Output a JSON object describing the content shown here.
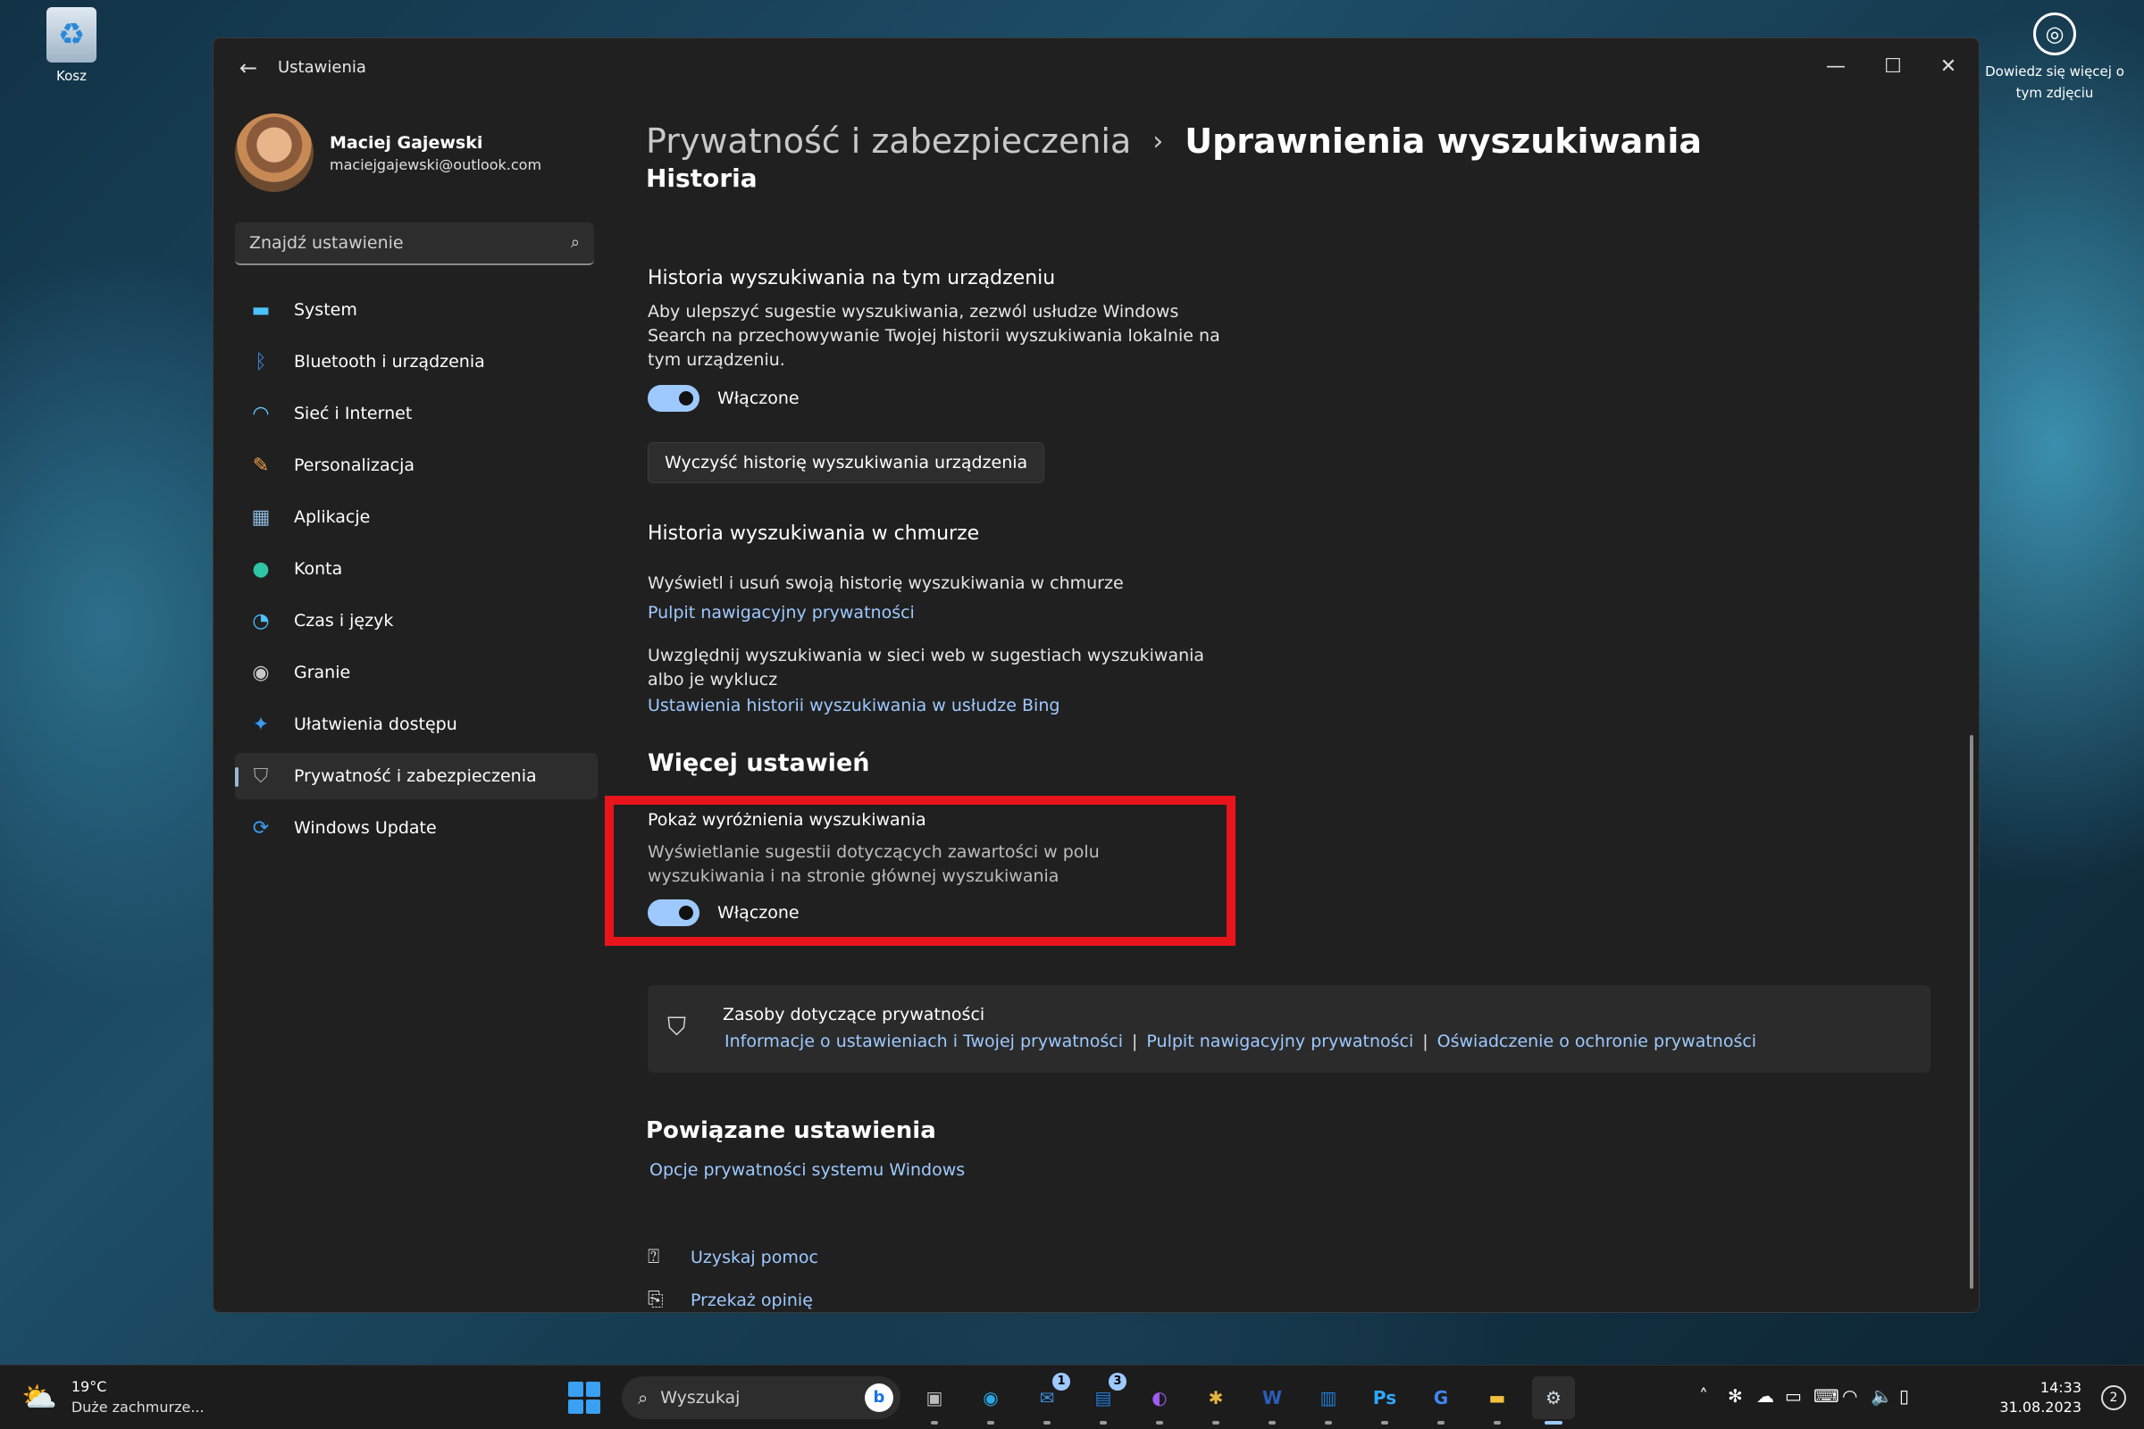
{
  "desktop": {
    "recycle_label": "Kosz",
    "learn_more": "Dowiedz się więcej o tym zdjęciu"
  },
  "window": {
    "title": "Ustawienia",
    "controls": {
      "minimize": "—",
      "maximize": "☐",
      "close": "✕"
    }
  },
  "profile": {
    "name": "Maciej Gajewski",
    "email": "maciejgajewski@outlook.com"
  },
  "search": {
    "placeholder": "Znajdź ustawienie"
  },
  "sidebar": {
    "items": [
      {
        "label": "System",
        "icon": "monitor-icon",
        "color": "#4cc2ff"
      },
      {
        "label": "Bluetooth i urządzenia",
        "icon": "bluetooth-icon",
        "color": "#3a8dde"
      },
      {
        "label": "Sieć i Internet",
        "icon": "wifi-icon",
        "color": "#60cdff"
      },
      {
        "label": "Personalizacja",
        "icon": "brush-icon",
        "color": "#f0a04b"
      },
      {
        "label": "Aplikacje",
        "icon": "apps-icon",
        "color": "#8ab4d8"
      },
      {
        "label": "Konta",
        "icon": "user-icon",
        "color": "#2ec4a4"
      },
      {
        "label": "Czas i język",
        "icon": "clock-globe-icon",
        "color": "#4cc2ff"
      },
      {
        "label": "Granie",
        "icon": "gamepad-icon",
        "color": "#c8c8c8"
      },
      {
        "label": "Ułatwienia dostępu",
        "icon": "accessibility-icon",
        "color": "#3a9bf0"
      },
      {
        "label": "Prywatność i zabezpieczenia",
        "icon": "shield-icon",
        "color": "#a8a8a8",
        "active": true
      },
      {
        "label": "Windows Update",
        "icon": "update-icon",
        "color": "#3a9bf0"
      }
    ]
  },
  "breadcrumb": {
    "parent": "Prywatność i zabezpieczenia",
    "separator": "›",
    "current": "Uprawnienia wyszukiwania"
  },
  "history": {
    "section_title": "Historia",
    "device": {
      "title": "Historia wyszukiwania na tym urządzeniu",
      "description": "Aby ulepszyć sugestie wyszukiwania, zezwól usłudze Windows Search na przechowywanie Twojej historii wyszukiwania lokalnie na tym urządzeniu.",
      "toggle_label": "Włączone",
      "clear_button": "Wyczyść historię wyszukiwania urządzenia"
    },
    "cloud": {
      "title": "Historia wyszukiwania w chmurze",
      "view_text": "Wyświetl i usuń swoją historię wyszukiwania w chmurze",
      "view_link": "Pulpit nawigacyjny prywatności",
      "web_text": "Uwzględnij wyszukiwania w sieci web w sugestiach wyszukiwania albo je wyklucz",
      "web_link": "Ustawienia historii wyszukiwania w usłudze Bing"
    }
  },
  "more_settings": {
    "title": "Więcej ustawień",
    "highlights": {
      "title": "Pokaż wyróżnienia wyszukiwania",
      "description": "Wyświetlanie sugestii dotyczących zawartości w polu wyszukiwania i na stronie głównej wyszukiwania",
      "toggle_label": "Włączone",
      "highlight_color": "#e8141c"
    }
  },
  "resources": {
    "title": "Zasoby dotyczące prywatności",
    "links": [
      "Informacje o ustawieniach i Twojej prywatności",
      "Pulpit nawigacyjny prywatności",
      "Oświadczenie o ochronie prywatności"
    ],
    "separator": "|"
  },
  "related": {
    "title": "Powiązane ustawienia",
    "link": "Opcje prywatności systemu Windows"
  },
  "footer": {
    "help": "Uzyskaj pomoc",
    "feedback": "Przekaż opinię"
  },
  "taskbar": {
    "weather_temp": "19°C",
    "weather_desc": "Duże zachmurze...",
    "search_text": "Wyszukaj",
    "bing_glyph": "b",
    "apps": [
      {
        "name": "task-view",
        "glyph": "▣",
        "color": "#bbbbbb"
      },
      {
        "name": "edge",
        "glyph": "◉",
        "color": "#2aa7e0"
      },
      {
        "name": "mail",
        "glyph": "✉",
        "color": "#3a8dde",
        "badge": "1"
      },
      {
        "name": "outlook",
        "glyph": "▤",
        "color": "#1f7bd6",
        "badge": "3"
      },
      {
        "name": "messenger",
        "glyph": "◐",
        "color": "#a05cf0"
      },
      {
        "name": "slack",
        "glyph": "✱",
        "color": "#e8b341"
      },
      {
        "name": "word",
        "glyph": "W",
        "color": "#2b5eb8"
      },
      {
        "name": "trello",
        "glyph": "▥",
        "color": "#1f7bd6"
      },
      {
        "name": "photoshop",
        "glyph": "Ps",
        "color": "#31a8ff"
      },
      {
        "name": "translate",
        "glyph": "G",
        "color": "#4285f4"
      },
      {
        "name": "explorer",
        "glyph": "▬",
        "color": "#f3c03c"
      },
      {
        "name": "settings",
        "glyph": "⚙",
        "color": "#cfd8e2",
        "active": true
      }
    ],
    "tray": [
      "˄",
      "✻",
      "☁",
      "▭",
      "⌨",
      "◠",
      "🔈",
      "▯"
    ],
    "time": "14:33",
    "date": "31.08.2023",
    "notifications": "2"
  }
}
